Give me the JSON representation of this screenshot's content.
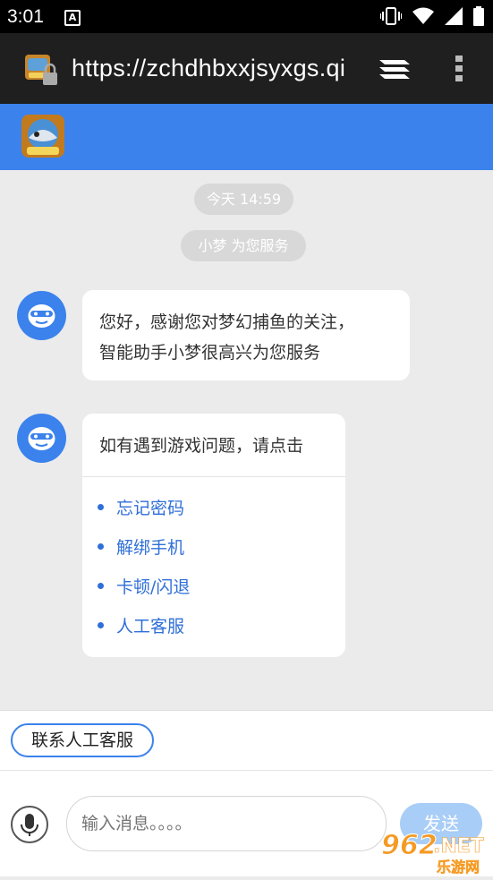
{
  "status_bar": {
    "time": "3:01",
    "a_badge": "A"
  },
  "browser": {
    "url": "https://zchdhbxxjsyxgs.qi"
  },
  "chat": {
    "timestamp_chip": "今天 14:59",
    "service_chip": "小梦 为您服务",
    "greeting_lines": [
      "您好，感谢您对梦幻捕鱼的关注，",
      "智能助手小梦很高兴为您服务"
    ],
    "question": "如有遇到游戏问题，请点击",
    "links": [
      "忘记密码",
      "解绑手机",
      "卡顿/闪退",
      "人工客服"
    ]
  },
  "footer": {
    "human_service_button": "联系人工客服",
    "input_placeholder": "输入消息。。。。",
    "send_label": "发送"
  },
  "watermark": {
    "text_962": "962",
    "text_net": ".NET",
    "text_cn": "乐游网"
  },
  "colors": {
    "accent": "#3b82ec",
    "link": "#2f6fd8",
    "send_disabled": "#a8cdf6",
    "background": "#ebebeb"
  }
}
